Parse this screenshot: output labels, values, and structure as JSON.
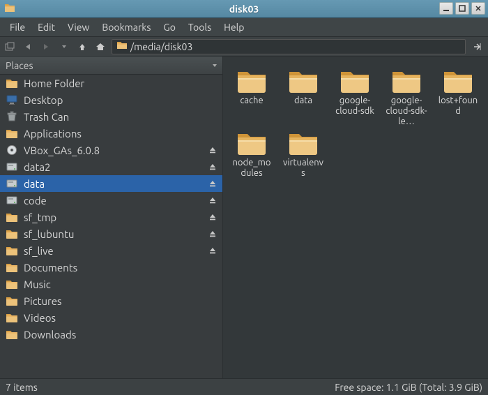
{
  "window": {
    "title": "disk03"
  },
  "menu": {
    "file": "File",
    "edit": "Edit",
    "view": "View",
    "bookmarks": "Bookmarks",
    "go": "Go",
    "tools": "Tools",
    "help": "Help"
  },
  "path": "/media/disk03",
  "sidebar": {
    "header": "Places",
    "items": [
      {
        "label": "Home Folder",
        "icon": "folder",
        "eject": false
      },
      {
        "label": "Desktop",
        "icon": "desktop",
        "eject": false
      },
      {
        "label": "Trash Can",
        "icon": "trash",
        "eject": false
      },
      {
        "label": "Applications",
        "icon": "folder",
        "eject": false
      },
      {
        "label": "VBox_GAs_6.0.8",
        "icon": "disc",
        "eject": true
      },
      {
        "label": "data2",
        "icon": "hdd",
        "eject": true
      },
      {
        "label": "data",
        "icon": "hdd",
        "eject": true,
        "selected": true
      },
      {
        "label": "code",
        "icon": "hdd",
        "eject": true
      },
      {
        "label": "sf_tmp",
        "icon": "folder",
        "eject": true
      },
      {
        "label": "sf_lubuntu",
        "icon": "folder",
        "eject": true
      },
      {
        "label": "sf_live",
        "icon": "folder",
        "eject": true
      },
      {
        "label": "Documents",
        "icon": "folder",
        "eject": false
      },
      {
        "label": "Music",
        "icon": "folder",
        "eject": false
      },
      {
        "label": "Pictures",
        "icon": "folder",
        "eject": false
      },
      {
        "label": "Videos",
        "icon": "folder",
        "eject": false
      },
      {
        "label": "Downloads",
        "icon": "folder",
        "eject": false
      }
    ]
  },
  "folders": [
    {
      "label": "cache"
    },
    {
      "label": "data"
    },
    {
      "label": "google-cloud-sdk"
    },
    {
      "label": "google-cloud-sdk-le…"
    },
    {
      "label": "lost+found"
    },
    {
      "label": "node_modules"
    },
    {
      "label": "virtualenvs"
    }
  ],
  "status": {
    "left": "7 items",
    "right": "Free space: 1.1 GiB (Total: 3.9 GiB)"
  }
}
